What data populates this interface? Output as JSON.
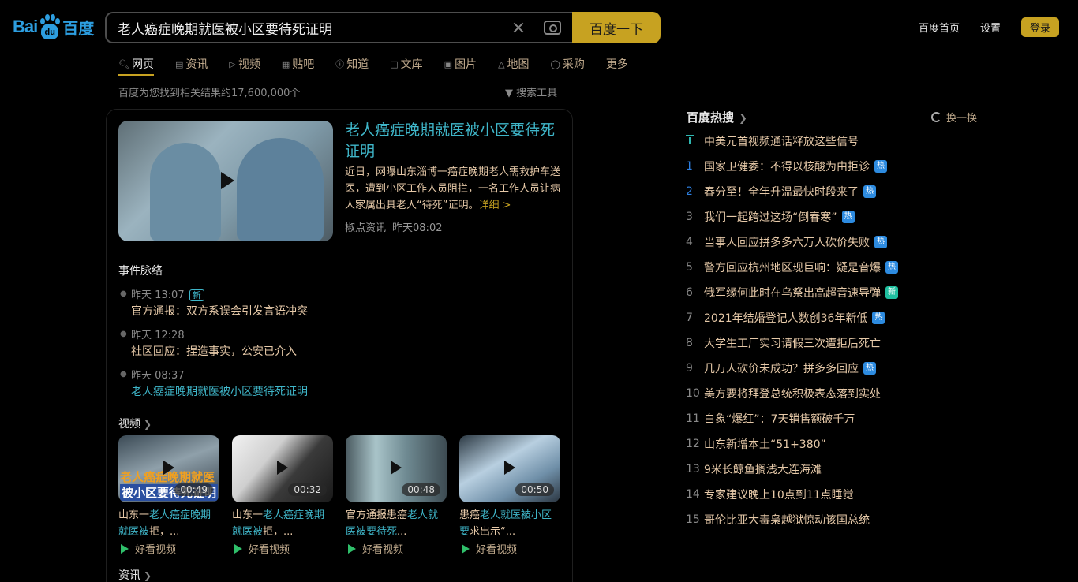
{
  "header": {
    "logo_left": "Bai",
    "logo_pad": "du",
    "logo_right": "百度",
    "search_query": "老人癌症晚期就医被小区要待死证明",
    "search_button": "百度一下",
    "links": [
      "百度首页",
      "设置"
    ],
    "login": "登录"
  },
  "tabs": [
    {
      "label": "网页",
      "icon": "search-icon"
    },
    {
      "label": "资讯",
      "icon": "news-icon"
    },
    {
      "label": "视频",
      "icon": "video-icon"
    },
    {
      "label": "贴吧",
      "icon": "tieba-icon"
    },
    {
      "label": "知道",
      "icon": "question-icon"
    },
    {
      "label": "文库",
      "icon": "doc-icon"
    },
    {
      "label": "图片",
      "icon": "image-icon"
    },
    {
      "label": "地图",
      "icon": "map-icon"
    },
    {
      "label": "采购",
      "icon": "cart-icon"
    },
    {
      "label": "更多",
      "icon": ""
    }
  ],
  "results": {
    "count_text": "百度为您找到相关结果约17,600,000个",
    "tools": "搜索工具"
  },
  "news": {
    "title": "老人癌症晚期就医被小区要待死证明",
    "summary": "近日，网曝山东淄博一癌症晚期老人需救护车送医，遭到小区工作人员阻拦，一名工作人员让病人家属出具老人“待死”证明。",
    "more": "详细 >",
    "source": "椒点资讯",
    "time": "昨天08:02"
  },
  "events": {
    "title": "事件脉络",
    "items": [
      {
        "time": "昨天 13:07",
        "badge": "新",
        "text": "官方通报：双方系误会引发言语冲突"
      },
      {
        "time": "昨天 12:28",
        "badge": "",
        "text": "社区回应：捏造事实，公安已介入"
      },
      {
        "time": "昨天 08:37",
        "badge": "",
        "text": "老人癌症晚期就医被小区要待死证明"
      }
    ]
  },
  "videos": {
    "label": "视频",
    "items": [
      {
        "duration": "00:49",
        "pre": "山东一",
        "em": "老人癌症晚期就医被",
        "post": "拒，...",
        "source": "好看视频",
        "overlay1": "老人癌症晚期就医",
        "overlay2": "被小区要待死证明"
      },
      {
        "duration": "00:32",
        "pre": "山东一",
        "em": "老人癌症晚期就医被",
        "post": "拒，...",
        "source": "好看视频"
      },
      {
        "duration": "00:48",
        "pre": "官方通报患癌",
        "em": "老人就医被要待死",
        "post": "...",
        "source": "好看视频"
      },
      {
        "duration": "00:50",
        "pre": "患癌",
        "em": "老人就医被小区要",
        "post": "求出示“...",
        "source": "好看视频"
      }
    ]
  },
  "info_label": "资讯",
  "hot": {
    "title": "百度热搜",
    "refresh": "换一换",
    "items": [
      {
        "rank": "",
        "text": "中美元首视频通话释放这些信号",
        "badge": ""
      },
      {
        "rank": "1",
        "text": "国家卫健委：不得以核酸为由拒诊",
        "badge": "热"
      },
      {
        "rank": "2",
        "text": "春分至！全年升温最快时段来了",
        "badge": "热"
      },
      {
        "rank": "3",
        "text": "我们一起跨过这场“倒春寒”",
        "badge": "热"
      },
      {
        "rank": "4",
        "text": "当事人回应拼多多六万人砍价失败",
        "badge": "热"
      },
      {
        "rank": "5",
        "text": "警方回应杭州地区现巨响：疑是音爆",
        "badge": "热"
      },
      {
        "rank": "6",
        "text": "俄军缘何此时在乌祭出高超音速导弹",
        "badge": "新"
      },
      {
        "rank": "7",
        "text": "2021年结婚登记人数创36年新低",
        "badge": "热"
      },
      {
        "rank": "8",
        "text": "大学生工厂实习请假三次遭拒后死亡",
        "badge": ""
      },
      {
        "rank": "9",
        "text": "几万人砍价未成功？拼多多回应",
        "badge": "热"
      },
      {
        "rank": "10",
        "text": "美方要将拜登总统积极表态落到实处",
        "badge": ""
      },
      {
        "rank": "11",
        "text": "白象“爆红”：7天销售额破千万",
        "badge": ""
      },
      {
        "rank": "12",
        "text": "山东新增本土“51+380”",
        "badge": ""
      },
      {
        "rank": "13",
        "text": "9米长鲸鱼搁浅大连海滩",
        "badge": ""
      },
      {
        "rank": "14",
        "text": "专家建议晚上10点到11点睡觉",
        "badge": ""
      },
      {
        "rank": "15",
        "text": "哥伦比亚大毒枭越狱惊动该国总统",
        "badge": ""
      }
    ]
  },
  "colors": {
    "accent": "#c7a221",
    "link": "#3fb6c9",
    "hot_badge": "#2d8be0",
    "new_badge": "#1fbf9f"
  }
}
